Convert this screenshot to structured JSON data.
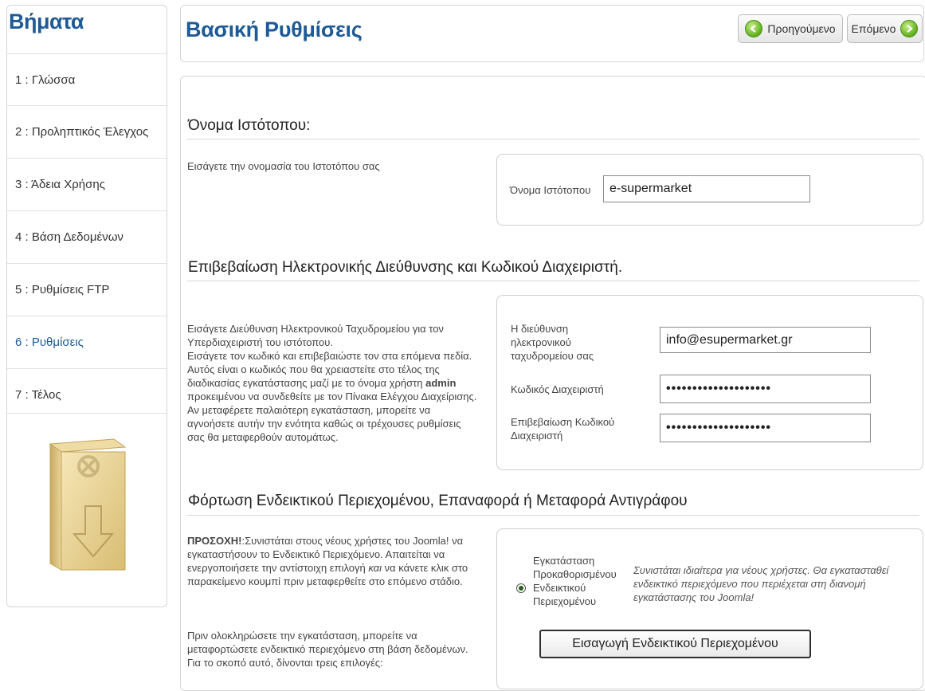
{
  "sidebar": {
    "title": "Βήματα",
    "steps": [
      {
        "label": "1 : Γλώσσα"
      },
      {
        "label": "2 : Προληπτικός Έλεγχος"
      },
      {
        "label": "3 : Άδεια Χρήσης"
      },
      {
        "label": "4 : Βάση Δεδομένων"
      },
      {
        "label": "5 : Ρυθμίσεις FTP"
      },
      {
        "label": "6 : Ρυθμίσεις"
      },
      {
        "label": "7 : Τέλος"
      }
    ],
    "active_step": 6
  },
  "header": {
    "title": "Βασική Ρυθμίσεις",
    "prev_label": "Προηγούμενο",
    "next_label": "Επόμενο"
  },
  "site_name": {
    "section_title": "Όνομα Ιστότοπου:",
    "description": "Εισάγετε την ονομασία του Ιστοτόπου σας",
    "field_label": "Όνομα Ιστότοπου",
    "field_value": "e-supermarket"
  },
  "admin": {
    "section_title": "Επιβεβαίωση Ηλεκτρονικής Διεύθυνσης και Κωδικού Διαχειριστή.",
    "desc_line1": "Εισάγετε Διεύθυνση Ηλεκτρονικού Ταχυδρομείου για τον",
    "desc_line2": "Υπερδιαχειριστή του ιστότοπου.",
    "desc_line3": "Εισάγετε τον κωδικό και επιβεβαιώστε τον στα επόμενα πεδία.",
    "desc_line4": "Αυτός είναι ο κωδικός που θα χρειαστείτε στο τέλος της",
    "desc_line5_pre": "διαδικασίας εγκατάστασης μαζί με το όνομα χρήστη ",
    "desc_line5_bold": "admin",
    "desc_line6": "προκειμένου να συνδεθείτε με τον Πίνακα Ελέγχου Διαχείρισης.",
    "desc_line7": "Αν μεταφέρετε παλαιότερη εγκατάσταση, μπορείτε να",
    "desc_line8": "αγνοήσετε αυτήν την ενότητα καθώς οι τρέχουσες ρυθμίσεις",
    "desc_line9": "σας θα μεταφερθούν αυτομάτως.",
    "email_label_1": "Η διεύθυνση",
    "email_label_2": "ηλεκτρονικού",
    "email_label_3": "ταχυδρομείου σας",
    "email_value": "info@esupermarket.gr",
    "password_label": "Κωδικός Διαχειριστή",
    "password_value": "••••••••••••••••••••",
    "confirm_label_1": "Επιβεβαίωση Κωδικού",
    "confirm_label_2": "Διαχειριστή",
    "confirm_value": "••••••••••••••••••••"
  },
  "sample": {
    "section_title": "Φόρτωση Ενδεικτικού Περιεχομένου, Επαναφορά ή Μεταφορά Αντιγράφου",
    "warn_bold": "ΠΡΟΣΟΧΗ!",
    "warn_line1": ":Συνιστάται στους νέους χρήστες του Joomla! να",
    "warn_line2": "εγκαταστήσουν το Ενδεικτικό Περιεχόμενο. Απαιτείται να",
    "warn_line3_pre": "ενεργοποιήσετε την αντίστοιχη επιλογή ",
    "warn_line3_em": "και",
    "warn_line3_post": " να κάνετε κλικ στο",
    "warn_line4": "παρακείμενο κουμπί πριν μεταφερθείτε στο επόμενο στάδιο.",
    "more_line1": "Πριν ολοκληρώσετε την εγκατάσταση, μπορείτε να",
    "more_line2": "μεταφορτώσετε ενδεικτικό περιεχόμενο στη βάση δεδομένων.",
    "more_line3": "Για το σκοπό αυτό, δίνονται τρεις επιλογές:",
    "radio_label_1": "Εγκατάσταση",
    "radio_label_2": "Προκαθορισμένου",
    "radio_label_3": "Ενδεικτικού",
    "radio_label_4": "Περιεχομένου",
    "hint_line1": "Συνιστάται ιδιαίτερα για νέους χρήστες. Θα εγκατασταθεί",
    "hint_line2": "ενδεικτικό περιεχόμενο που περιέχεται στη διανομή",
    "hint_line3": "εγκατάστασης του Joomla!",
    "install_button": "Εισαγωγή Ενδεικτικού Περιεχομένου"
  },
  "colors": {
    "accent": "#1d5a96",
    "go_green": "#5fae1c"
  }
}
